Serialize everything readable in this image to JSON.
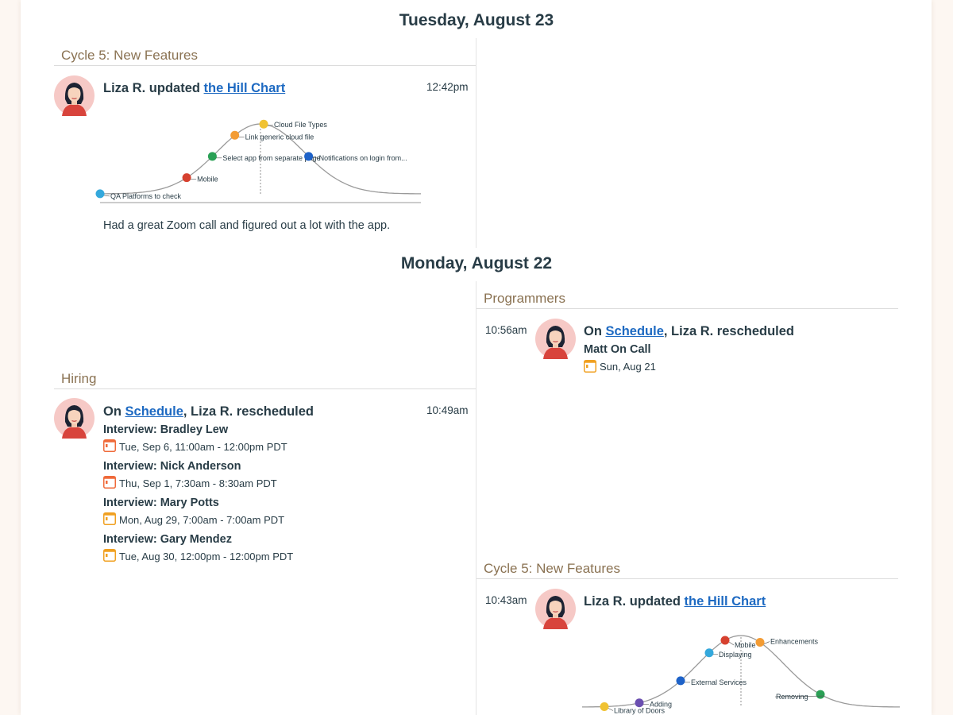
{
  "days": [
    {
      "heading": "Tuesday, August 23",
      "activities": [
        {
          "bucket": "Cycle 5: New Features",
          "actor": "Liza R.",
          "verb": "updated",
          "link": "the Hill Chart",
          "time": "12:42pm",
          "hill_chart": {
            "items": [
              {
                "label": "QA Platforms to check",
                "color": "#34a8dc",
                "position": 0.0
              },
              {
                "label": "Mobile",
                "color": "#d6412f",
                "position": 0.27
              },
              {
                "label": "Select app from separate page",
                "color": "#2aa055",
                "position": 0.35
              },
              {
                "label": "Link generic cloud file",
                "color": "#f39c34",
                "position": 0.42
              },
              {
                "label": "Cloud File Types",
                "color": "#f0c232",
                "position": 0.51
              },
              {
                "label": "Notifications on login from...",
                "color": "#1e62c8",
                "position": 0.65
              }
            ]
          },
          "note": "Had a great Zoom call and figured out a lot with the app."
        }
      ]
    },
    {
      "heading": "Monday, August 22",
      "activities": [
        {
          "bucket": "Programmers",
          "time": "10:56am",
          "prefix": "On",
          "link": "Schedule",
          "suffix": ", Liza R. rescheduled",
          "events": [
            {
              "title": "Matt On Call",
              "date": "Sun, Aug 21",
              "icon": "calendar-icon",
              "icon_color": "#f0a020"
            }
          ]
        },
        {
          "bucket": "Hiring",
          "time": "10:49am",
          "prefix": "On",
          "link": "Schedule",
          "suffix": ", Liza R. rescheduled",
          "events": [
            {
              "title": "Interview: Bradley Lew",
              "date": "Tue, Sep 6, 11:00am - 12:00pm PDT",
              "icon": "calendar-icon",
              "icon_color": "#ef6a3a"
            },
            {
              "title": "Interview: Nick Anderson",
              "date": "Thu, Sep 1, 7:30am - 8:30am PDT",
              "icon": "calendar-icon",
              "icon_color": "#ef6a3a"
            },
            {
              "title": "Interview: Mary Potts",
              "date": "Mon, Aug 29, 7:00am - 7:00am PDT",
              "icon": "calendar-icon",
              "icon_color": "#f0a020"
            },
            {
              "title": "Interview: Gary Mendez",
              "date": "Tue, Aug 30, 12:00pm - 12:00pm PDT",
              "icon": "calendar-icon",
              "icon_color": "#f0a020"
            }
          ]
        },
        {
          "bucket": "Cycle 5: New Features",
          "time": "10:43am",
          "actor": "Liza R.",
          "verb": "updated",
          "link": "the Hill Chart",
          "hill_chart": {
            "items": [
              {
                "label": "Library of Doors",
                "color": "#f0c232",
                "position": 0.07
              },
              {
                "label": "Adding",
                "color": "#6b4fb0",
                "position": 0.18
              },
              {
                "label": "External Services",
                "color": "#1e62c8",
                "position": 0.31
              },
              {
                "label": "Displaying",
                "color": "#34a8dc",
                "position": 0.4
              },
              {
                "label": "Mobile",
                "color": "#d6412f",
                "position": 0.45
              },
              {
                "label": "Enhancements",
                "color": "#f39c34",
                "position": 0.56
              },
              {
                "label": "Removing",
                "color": "#2aa055",
                "position": 0.75
              }
            ]
          }
        }
      ]
    }
  ],
  "colors": {
    "bucket_title": "#8a7252",
    "link": "#1e6ac2",
    "text": "#283c46",
    "hill_curve": "#9a9a9a"
  }
}
